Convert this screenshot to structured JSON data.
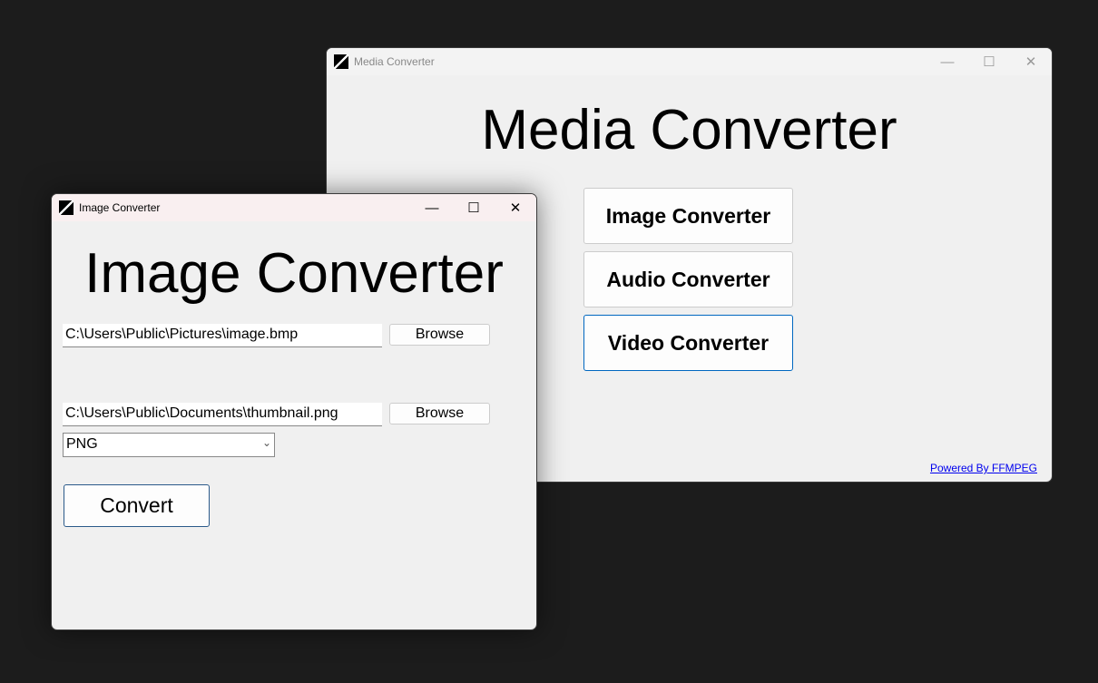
{
  "main_window": {
    "title": "Media Converter",
    "heading": "Media Converter",
    "buttons": [
      "Image Converter",
      "Audio Converter",
      "Video Converter"
    ],
    "link": "Powered By FFMPEG",
    "focused_button_border": "#0067c0"
  },
  "image_window": {
    "title": "Image Converter",
    "heading": "Image Converter",
    "input_path": "C:\\Users\\Public\\Pictures\\image.bmp",
    "output_path": "C:\\Users\\Public\\Documents\\thumbnail.png",
    "browse": "Browse",
    "format": "PNG",
    "convert": "Convert"
  },
  "controls": {
    "minimize": "—",
    "maximize": "☐",
    "close": "✕",
    "dropdown": "⌄"
  }
}
